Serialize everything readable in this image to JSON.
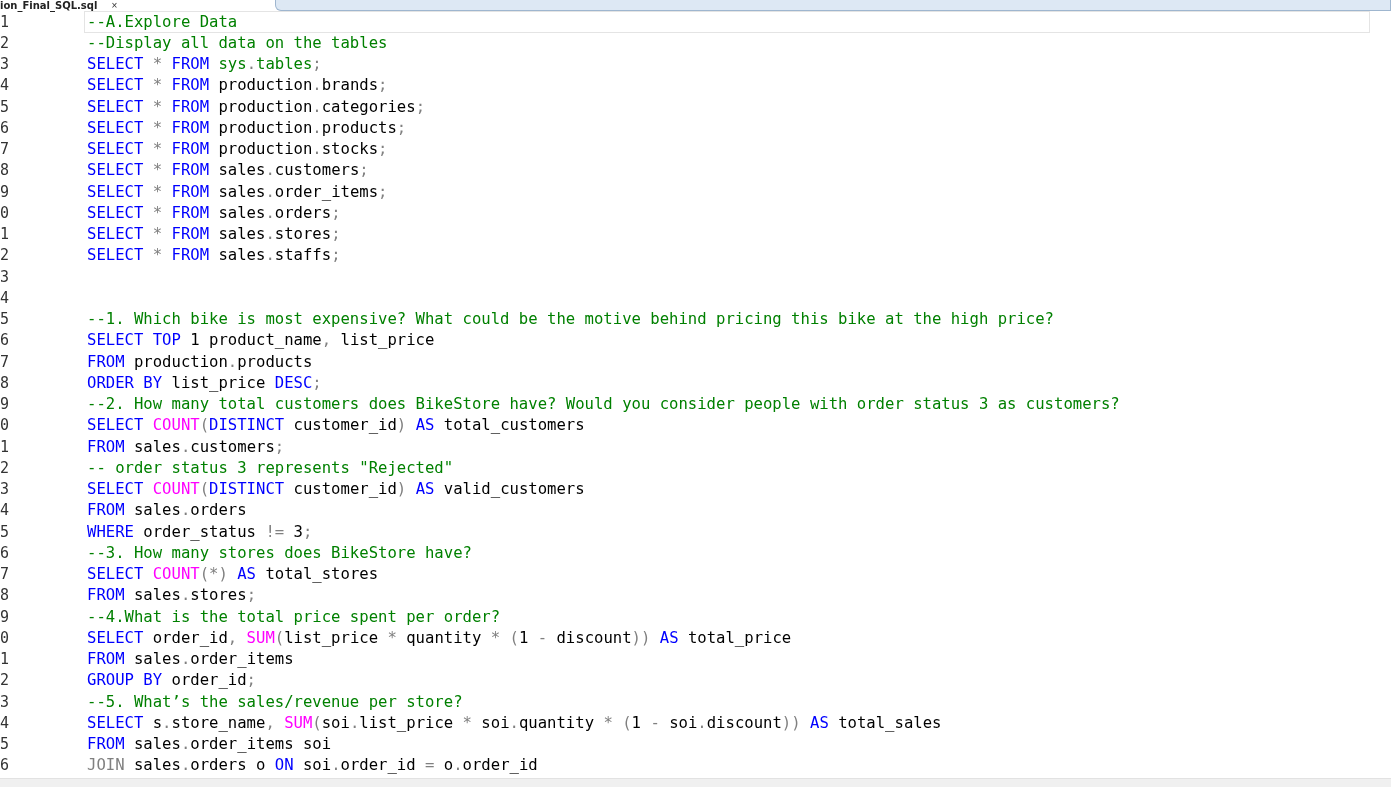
{
  "tab": {
    "title": "ion_Final_SQL.sql",
    "close": "×",
    "selected": true
  },
  "editor": {
    "lines": [
      {
        "number": "1",
        "current": true,
        "tokens": [
          {
            "kind": "comment",
            "text": "--A.Explore Data"
          }
        ]
      },
      {
        "number": "2",
        "current": false,
        "tokens": [
          {
            "kind": "comment",
            "text": "--Display all data on the tables"
          }
        ]
      },
      {
        "number": "3",
        "current": false,
        "tokens": [
          {
            "kind": "keyword",
            "text": "SELECT "
          },
          {
            "kind": "operator",
            "text": "* "
          },
          {
            "kind": "keyword",
            "text": "FROM "
          },
          {
            "kind": "system",
            "text": "sys"
          },
          {
            "kind": "operator",
            "text": "."
          },
          {
            "kind": "system",
            "text": "tables"
          },
          {
            "kind": "operator",
            "text": ";"
          }
        ]
      },
      {
        "number": "4",
        "current": false,
        "tokens": [
          {
            "kind": "keyword",
            "text": "SELECT "
          },
          {
            "kind": "operator",
            "text": "* "
          },
          {
            "kind": "keyword",
            "text": "FROM "
          },
          {
            "kind": "plain",
            "text": "production"
          },
          {
            "kind": "operator",
            "text": "."
          },
          {
            "kind": "plain",
            "text": "brands"
          },
          {
            "kind": "operator",
            "text": ";"
          }
        ]
      },
      {
        "number": "5",
        "current": false,
        "tokens": [
          {
            "kind": "keyword",
            "text": "SELECT "
          },
          {
            "kind": "operator",
            "text": "* "
          },
          {
            "kind": "keyword",
            "text": "FROM "
          },
          {
            "kind": "plain",
            "text": "production"
          },
          {
            "kind": "operator",
            "text": "."
          },
          {
            "kind": "plain",
            "text": "categories"
          },
          {
            "kind": "operator",
            "text": ";"
          }
        ]
      },
      {
        "number": "6",
        "current": false,
        "tokens": [
          {
            "kind": "keyword",
            "text": "SELECT "
          },
          {
            "kind": "operator",
            "text": "* "
          },
          {
            "kind": "keyword",
            "text": "FROM "
          },
          {
            "kind": "plain",
            "text": "production"
          },
          {
            "kind": "operator",
            "text": "."
          },
          {
            "kind": "plain",
            "text": "products"
          },
          {
            "kind": "operator",
            "text": ";"
          }
        ]
      },
      {
        "number": "7",
        "current": false,
        "tokens": [
          {
            "kind": "keyword",
            "text": "SELECT "
          },
          {
            "kind": "operator",
            "text": "* "
          },
          {
            "kind": "keyword",
            "text": "FROM "
          },
          {
            "kind": "plain",
            "text": "production"
          },
          {
            "kind": "operator",
            "text": "."
          },
          {
            "kind": "plain",
            "text": "stocks"
          },
          {
            "kind": "operator",
            "text": ";"
          }
        ]
      },
      {
        "number": "8",
        "current": false,
        "tokens": [
          {
            "kind": "keyword",
            "text": "SELECT "
          },
          {
            "kind": "operator",
            "text": "* "
          },
          {
            "kind": "keyword",
            "text": "FROM "
          },
          {
            "kind": "plain",
            "text": "sales"
          },
          {
            "kind": "operator",
            "text": "."
          },
          {
            "kind": "plain",
            "text": "customers"
          },
          {
            "kind": "operator",
            "text": ";"
          }
        ]
      },
      {
        "number": "9",
        "current": false,
        "tokens": [
          {
            "kind": "keyword",
            "text": "SELECT "
          },
          {
            "kind": "operator",
            "text": "* "
          },
          {
            "kind": "keyword",
            "text": "FROM "
          },
          {
            "kind": "plain",
            "text": "sales"
          },
          {
            "kind": "operator",
            "text": "."
          },
          {
            "kind": "plain",
            "text": "order_items"
          },
          {
            "kind": "operator",
            "text": ";"
          }
        ]
      },
      {
        "number": "0",
        "current": false,
        "tokens": [
          {
            "kind": "keyword",
            "text": "SELECT "
          },
          {
            "kind": "operator",
            "text": "* "
          },
          {
            "kind": "keyword",
            "text": "FROM "
          },
          {
            "kind": "plain",
            "text": "sales"
          },
          {
            "kind": "operator",
            "text": "."
          },
          {
            "kind": "plain",
            "text": "orders"
          },
          {
            "kind": "operator",
            "text": ";"
          }
        ]
      },
      {
        "number": "1",
        "current": false,
        "tokens": [
          {
            "kind": "keyword",
            "text": "SELECT "
          },
          {
            "kind": "operator",
            "text": "* "
          },
          {
            "kind": "keyword",
            "text": "FROM "
          },
          {
            "kind": "plain",
            "text": "sales"
          },
          {
            "kind": "operator",
            "text": "."
          },
          {
            "kind": "plain",
            "text": "stores"
          },
          {
            "kind": "operator",
            "text": ";"
          }
        ]
      },
      {
        "number": "2",
        "current": false,
        "tokens": [
          {
            "kind": "keyword",
            "text": "SELECT "
          },
          {
            "kind": "operator",
            "text": "* "
          },
          {
            "kind": "keyword",
            "text": "FROM "
          },
          {
            "kind": "plain",
            "text": "sales"
          },
          {
            "kind": "operator",
            "text": "."
          },
          {
            "kind": "plain",
            "text": "staffs"
          },
          {
            "kind": "operator",
            "text": ";"
          }
        ]
      },
      {
        "number": "3",
        "current": false
      },
      {
        "number": "4",
        "current": false
      },
      {
        "number": "5",
        "current": false,
        "tokens": [
          {
            "kind": "comment",
            "text": "--1. Which bike is most expensive? What could be the motive behind pricing this bike at the high price?"
          }
        ]
      },
      {
        "number": "6",
        "current": false,
        "tokens": [
          {
            "kind": "keyword",
            "text": "SELECT TOP "
          },
          {
            "kind": "plain",
            "text": "1 product_name"
          },
          {
            "kind": "operator",
            "text": ", "
          },
          {
            "kind": "plain",
            "text": "list_price"
          }
        ]
      },
      {
        "number": "7",
        "current": false,
        "tokens": [
          {
            "kind": "keyword",
            "text": "FROM "
          },
          {
            "kind": "plain",
            "text": "production"
          },
          {
            "kind": "operator",
            "text": "."
          },
          {
            "kind": "plain",
            "text": "products"
          }
        ]
      },
      {
        "number": "8",
        "current": false,
        "tokens": [
          {
            "kind": "keyword",
            "text": "ORDER BY "
          },
          {
            "kind": "plain",
            "text": "list_price "
          },
          {
            "kind": "keyword",
            "text": "DESC"
          },
          {
            "kind": "operator",
            "text": ";"
          }
        ]
      },
      {
        "number": "9",
        "current": false,
        "tokens": [
          {
            "kind": "comment",
            "text": "--2. How many total customers does BikeStore have? Would you consider people with order status 3 as customers?"
          }
        ]
      },
      {
        "number": "0",
        "current": false,
        "tokens": [
          {
            "kind": "keyword",
            "text": "SELECT "
          },
          {
            "kind": "function",
            "text": "COUNT"
          },
          {
            "kind": "operator",
            "text": "("
          },
          {
            "kind": "keyword",
            "text": "DISTINCT "
          },
          {
            "kind": "plain",
            "text": "customer_id"
          },
          {
            "kind": "operator",
            "text": ") "
          },
          {
            "kind": "keyword",
            "text": "AS "
          },
          {
            "kind": "plain",
            "text": "total_customers"
          }
        ]
      },
      {
        "number": "1",
        "current": false,
        "tokens": [
          {
            "kind": "keyword",
            "text": "FROM "
          },
          {
            "kind": "plain",
            "text": "sales"
          },
          {
            "kind": "operator",
            "text": "."
          },
          {
            "kind": "plain",
            "text": "customers"
          },
          {
            "kind": "operator",
            "text": ";"
          }
        ]
      },
      {
        "number": "2",
        "current": false,
        "tokens": [
          {
            "kind": "comment",
            "text": "-- order status 3 represents \"Rejected\""
          }
        ]
      },
      {
        "number": "3",
        "current": false,
        "tokens": [
          {
            "kind": "keyword",
            "text": "SELECT "
          },
          {
            "kind": "function",
            "text": "COUNT"
          },
          {
            "kind": "operator",
            "text": "("
          },
          {
            "kind": "keyword",
            "text": "DISTINCT "
          },
          {
            "kind": "plain",
            "text": "customer_id"
          },
          {
            "kind": "operator",
            "text": ") "
          },
          {
            "kind": "keyword",
            "text": "AS "
          },
          {
            "kind": "plain",
            "text": "valid_customers"
          }
        ]
      },
      {
        "number": "4",
        "current": false,
        "tokens": [
          {
            "kind": "keyword",
            "text": "FROM "
          },
          {
            "kind": "plain",
            "text": "sales"
          },
          {
            "kind": "operator",
            "text": "."
          },
          {
            "kind": "plain",
            "text": "orders"
          }
        ]
      },
      {
        "number": "5",
        "current": false,
        "tokens": [
          {
            "kind": "keyword",
            "text": "WHERE "
          },
          {
            "kind": "plain",
            "text": "order_status "
          },
          {
            "kind": "operator",
            "text": "!= "
          },
          {
            "kind": "plain",
            "text": "3"
          },
          {
            "kind": "operator",
            "text": ";"
          }
        ]
      },
      {
        "number": "6",
        "current": false,
        "tokens": [
          {
            "kind": "comment",
            "text": "--3. How many stores does BikeStore have?"
          }
        ]
      },
      {
        "number": "7",
        "current": false,
        "tokens": [
          {
            "kind": "keyword",
            "text": "SELECT "
          },
          {
            "kind": "function",
            "text": "COUNT"
          },
          {
            "kind": "operator",
            "text": "(*) "
          },
          {
            "kind": "keyword",
            "text": "AS "
          },
          {
            "kind": "plain",
            "text": "total_stores"
          }
        ]
      },
      {
        "number": "8",
        "current": false,
        "tokens": [
          {
            "kind": "keyword",
            "text": "FROM "
          },
          {
            "kind": "plain",
            "text": "sales"
          },
          {
            "kind": "operator",
            "text": "."
          },
          {
            "kind": "plain",
            "text": "stores"
          },
          {
            "kind": "operator",
            "text": ";"
          }
        ]
      },
      {
        "number": "9",
        "current": false,
        "tokens": [
          {
            "kind": "comment",
            "text": "--4.What is the total price spent per order?"
          }
        ]
      },
      {
        "number": "0",
        "current": false,
        "tokens": [
          {
            "kind": "keyword",
            "text": "SELECT "
          },
          {
            "kind": "plain",
            "text": "order_id"
          },
          {
            "kind": "operator",
            "text": ", "
          },
          {
            "kind": "function",
            "text": "SUM"
          },
          {
            "kind": "operator",
            "text": "("
          },
          {
            "kind": "plain",
            "text": "list_price "
          },
          {
            "kind": "operator",
            "text": "* "
          },
          {
            "kind": "plain",
            "text": "quantity "
          },
          {
            "kind": "operator",
            "text": "* ("
          },
          {
            "kind": "plain",
            "text": "1 "
          },
          {
            "kind": "operator",
            "text": "- "
          },
          {
            "kind": "plain",
            "text": "discount"
          },
          {
            "kind": "operator",
            "text": ")) "
          },
          {
            "kind": "keyword",
            "text": "AS "
          },
          {
            "kind": "plain",
            "text": "total_price"
          }
        ]
      },
      {
        "number": "1",
        "current": false,
        "tokens": [
          {
            "kind": "keyword",
            "text": "FROM "
          },
          {
            "kind": "plain",
            "text": "sales"
          },
          {
            "kind": "operator",
            "text": "."
          },
          {
            "kind": "plain",
            "text": "order_items"
          }
        ]
      },
      {
        "number": "2",
        "current": false,
        "tokens": [
          {
            "kind": "keyword",
            "text": "GROUP BY "
          },
          {
            "kind": "plain",
            "text": "order_id"
          },
          {
            "kind": "operator",
            "text": ";"
          }
        ]
      },
      {
        "number": "3",
        "current": false,
        "tokens": [
          {
            "kind": "comment",
            "text": "--5. What’s the sales/revenue per store?"
          }
        ]
      },
      {
        "number": "4",
        "current": false,
        "tokens": [
          {
            "kind": "keyword",
            "text": "SELECT "
          },
          {
            "kind": "plain",
            "text": "s"
          },
          {
            "kind": "operator",
            "text": "."
          },
          {
            "kind": "plain",
            "text": "store_name"
          },
          {
            "kind": "operator",
            "text": ", "
          },
          {
            "kind": "function",
            "text": "SUM"
          },
          {
            "kind": "operator",
            "text": "("
          },
          {
            "kind": "plain",
            "text": "soi"
          },
          {
            "kind": "operator",
            "text": "."
          },
          {
            "kind": "plain",
            "text": "list_price "
          },
          {
            "kind": "operator",
            "text": "* "
          },
          {
            "kind": "plain",
            "text": "soi"
          },
          {
            "kind": "operator",
            "text": "."
          },
          {
            "kind": "plain",
            "text": "quantity "
          },
          {
            "kind": "operator",
            "text": "* ("
          },
          {
            "kind": "plain",
            "text": "1 "
          },
          {
            "kind": "operator",
            "text": "- "
          },
          {
            "kind": "plain",
            "text": "soi"
          },
          {
            "kind": "operator",
            "text": "."
          },
          {
            "kind": "plain",
            "text": "discount"
          },
          {
            "kind": "operator",
            "text": ")) "
          },
          {
            "kind": "keyword",
            "text": "AS "
          },
          {
            "kind": "plain",
            "text": "total_sales"
          }
        ]
      },
      {
        "number": "5",
        "current": false,
        "tokens": [
          {
            "kind": "keyword",
            "text": "FROM "
          },
          {
            "kind": "plain",
            "text": "sales"
          },
          {
            "kind": "operator",
            "text": "."
          },
          {
            "kind": "plain",
            "text": "order_items soi"
          }
        ]
      },
      {
        "number": "6",
        "current": false,
        "tokens": [
          {
            "kind": "operator",
            "text": "JOIN "
          },
          {
            "kind": "plain",
            "text": "sales"
          },
          {
            "kind": "operator",
            "text": "."
          },
          {
            "kind": "plain",
            "text": "orders o "
          },
          {
            "kind": "keyword",
            "text": "ON "
          },
          {
            "kind": "plain",
            "text": "soi"
          },
          {
            "kind": "operator",
            "text": "."
          },
          {
            "kind": "plain",
            "text": "order_id "
          },
          {
            "kind": "operator",
            "text": "= "
          },
          {
            "kind": "plain",
            "text": "o"
          },
          {
            "kind": "operator",
            "text": "."
          },
          {
            "kind": "plain",
            "text": "order_id"
          }
        ]
      }
    ]
  }
}
